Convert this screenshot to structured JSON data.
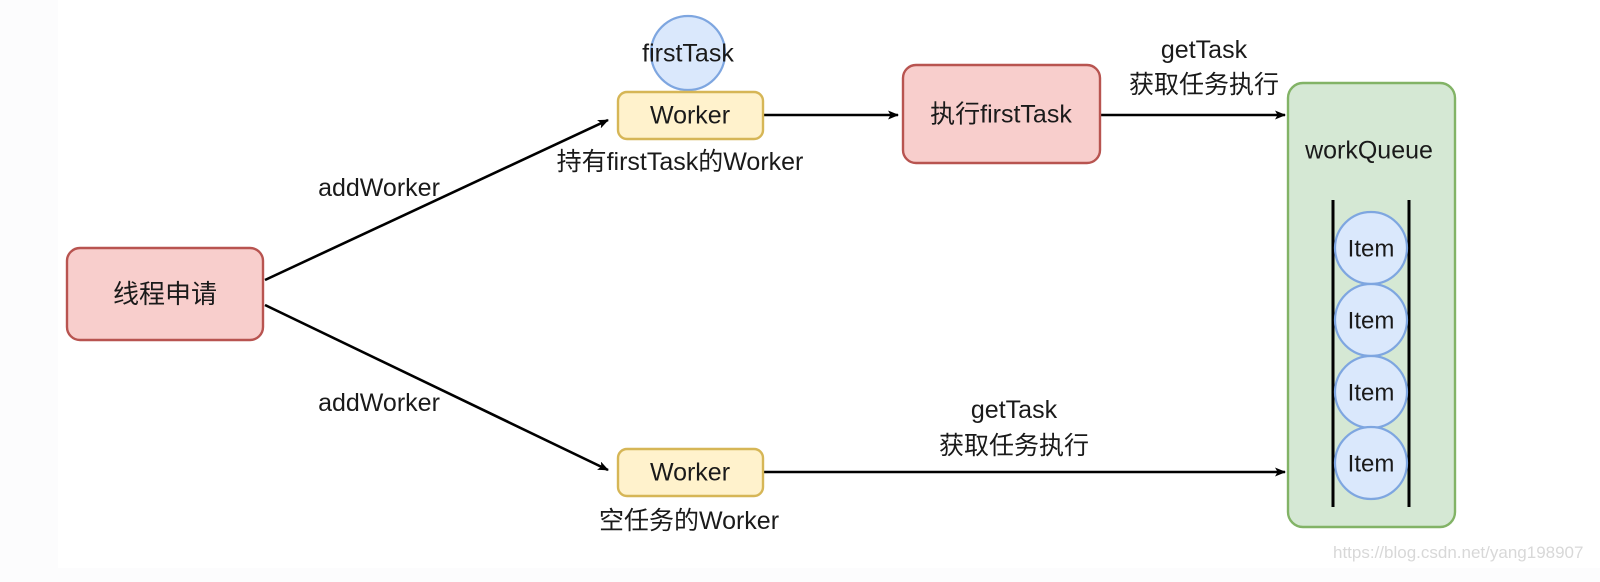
{
  "diagram": {
    "title": "Thread pool worker and work queue flow",
    "colors": {
      "pink_fill": "#f8cecc",
      "pink_stroke": "#b85450",
      "yellow_fill": "#fff2cc",
      "yellow_stroke": "#d6b656",
      "green_fill": "#d5e8d4",
      "green_stroke": "#82b366",
      "blue_fill": "#dae8fc",
      "blue_stroke": "#7ea6e0",
      "edge": "#000000",
      "text": "#1a1a1a",
      "watermark": "#d8d8d8",
      "canvas": "#ffffff"
    },
    "nodes": {
      "thread_request": {
        "label": "线程申请",
        "shape": "rounded-rect",
        "fill": "pink"
      },
      "worker_top": {
        "label": "Worker",
        "shape": "rounded-rect",
        "fill": "yellow"
      },
      "worker_bottom": {
        "label": "Worker",
        "shape": "rounded-rect",
        "fill": "yellow"
      },
      "first_task_circle": {
        "label": "firstTask",
        "shape": "circle",
        "fill": "blue"
      },
      "exec_first_task": {
        "label": "执行firstTask",
        "shape": "rounded-rect",
        "fill": "pink"
      },
      "work_queue": {
        "label": "workQueue",
        "shape": "rounded-rect",
        "fill": "green"
      }
    },
    "queue_items": [
      {
        "label": "Item"
      },
      {
        "label": "Item"
      },
      {
        "label": "Item"
      },
      {
        "label": "Item"
      }
    ],
    "edge_labels": {
      "add_worker_top": "addWorker",
      "add_worker_bottom": "addWorker",
      "get_task_top_line1": "getTask",
      "get_task_top_line2": "获取任务执行",
      "get_task_bottom_line1": "getTask",
      "get_task_bottom_line2": "获取任务执行"
    },
    "captions": {
      "worker_top_caption": "持有firstTask的Worker",
      "worker_bottom_caption": "空任务的Worker"
    },
    "watermark": "https://blog.csdn.net/yang198907"
  }
}
